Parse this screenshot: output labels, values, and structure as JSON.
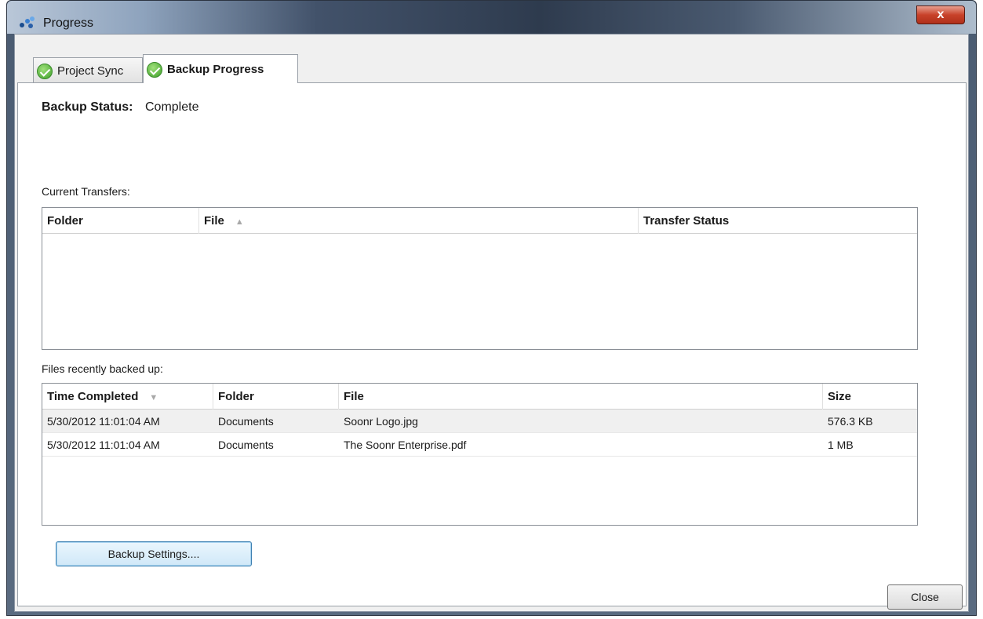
{
  "window": {
    "title": "Progress",
    "close_glyph": "x"
  },
  "tabs": [
    {
      "label": "Project Sync",
      "icon": "check-circle-icon",
      "active": false
    },
    {
      "label": "Backup Progress",
      "icon": "check-circle-icon",
      "active": true
    }
  ],
  "status": {
    "label": "Backup Status:",
    "value": "Complete"
  },
  "current_transfers": {
    "label": "Current Transfers:",
    "columns": [
      "Folder",
      "File",
      "Transfer Status"
    ],
    "sort_column": "File",
    "sort_direction": "ascending",
    "sort_glyph": "▲",
    "rows": []
  },
  "recent_backups": {
    "label": "Files recently backed up:",
    "columns": [
      "Time Completed",
      "Folder",
      "File",
      "Size"
    ],
    "sort_column": "Time Completed",
    "sort_direction": "descending",
    "sort_glyph": "▼",
    "rows": [
      {
        "time": "5/30/2012 11:01:04 AM",
        "folder": "Documents",
        "file": "Soonr Logo.jpg",
        "size": "576.3 KB"
      },
      {
        "time": "5/30/2012 11:01:04 AM",
        "folder": "Documents",
        "file": "The Soonr Enterprise.pdf",
        "size": "1 MB"
      }
    ]
  },
  "buttons": {
    "backup_settings": "Backup Settings....",
    "close": "Close"
  },
  "colors": {
    "check_green": "#3ea02a",
    "close_red": "#c8422a",
    "focus_blue": "#3c7fb1"
  }
}
